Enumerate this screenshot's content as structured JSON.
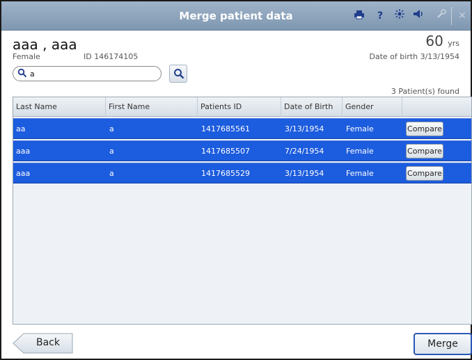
{
  "window": {
    "title": "Merge patient data"
  },
  "toolbar": {
    "icons": [
      "printer-icon",
      "help-icon",
      "brightness-icon",
      "volume-icon",
      "wrench-icon",
      "close-icon"
    ],
    "help_glyph": "?",
    "close_glyph": "✕"
  },
  "patient": {
    "name": "aaa , aaa",
    "sex": "Female",
    "id_text": "ID 146174105",
    "age": "60",
    "age_unit": "yrs",
    "dob_text": "Date of birth  3/13/1954"
  },
  "search": {
    "value": "a",
    "placeholder": ""
  },
  "results": {
    "count_text": "3  Patient(s) found"
  },
  "table": {
    "columns": [
      "Last Name",
      "First Name",
      "Patients ID",
      "Date of Birth",
      "Gender"
    ],
    "compare_label": "Compare",
    "rows": [
      {
        "last": "aa",
        "first": "a",
        "pid": "1417685561",
        "dob": "3/13/1954",
        "gender": "Female"
      },
      {
        "last": "aaa",
        "first": "a",
        "pid": "1417685507",
        "dob": "7/24/1954",
        "gender": "Female"
      },
      {
        "last": "aaa",
        "first": "a",
        "pid": "1417685529",
        "dob": "3/13/1954",
        "gender": "Female"
      }
    ]
  },
  "footer": {
    "back_label": "Back",
    "merge_label": "Merge"
  },
  "colors": {
    "titlebar": "#8aa1b9",
    "row_selected": "#1c5cde",
    "accent": "#2a58b8"
  }
}
